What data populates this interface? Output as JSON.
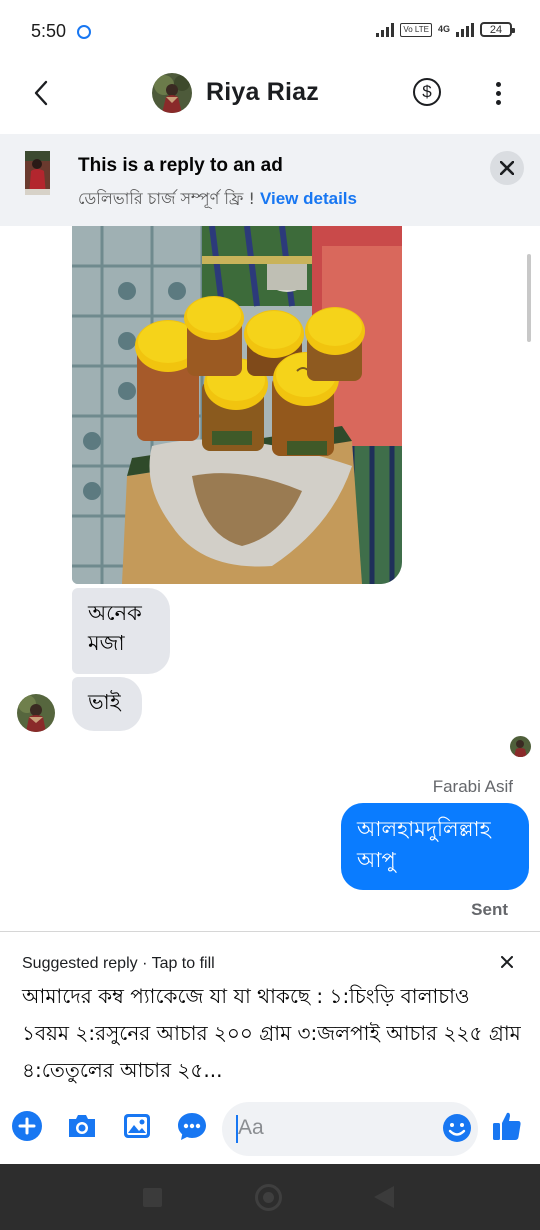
{
  "status_bar": {
    "time": "5:50",
    "network": "4G",
    "volte": "Vo LTE",
    "battery": "24"
  },
  "header": {
    "contact_name": "Riya Riaz"
  },
  "ad_banner": {
    "title": "This is a reply to an ad",
    "subtitle": "ডেলিভারি চার্জ সম্পূর্ণ ফ্রি !",
    "link": "View details"
  },
  "conversation": {
    "incoming_1": "অনেক মজা",
    "incoming_2": "ভাই",
    "sender_name": "Farabi Asif",
    "outgoing_1": "আলহামদুলিল্লাহ আপু",
    "status": "Sent"
  },
  "suggested_reply": {
    "label": "Suggested reply · Tap to fill",
    "text": "আমাদের কম্ব প্যাকেজে যা যা থাকছে : ১:চিংড়ি বালাচাও ১বয়ম ২:রসুনের আচার ২০০ গ্রাম ৩:জলপাই আচার ২২৫ গ্রাম ৪:তেতুলের আচার ২৫..."
  },
  "composer": {
    "placeholder": "Aa"
  },
  "colors": {
    "accent": "#1877f2",
    "outgoing_bubble": "#0a7cff",
    "incoming_bubble": "#e4e6eb",
    "banner_bg": "#f0f2f5"
  }
}
